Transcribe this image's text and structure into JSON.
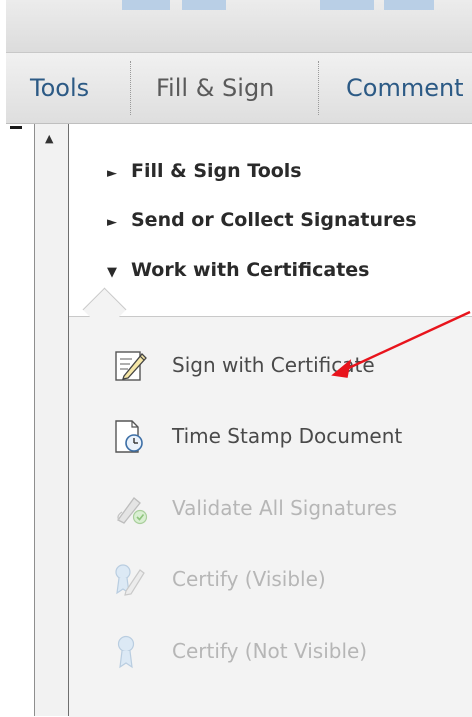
{
  "tabs": [
    {
      "label": "Tools"
    },
    {
      "label": "Fill & Sign"
    },
    {
      "label": "Comment"
    }
  ],
  "sections": [
    {
      "label": "Fill & Sign Tools",
      "expanded": false,
      "marker": "►"
    },
    {
      "label": "Send or Collect Signatures",
      "expanded": false,
      "marker": "►"
    },
    {
      "label": "Work with Certificates",
      "expanded": true,
      "marker": "▼"
    }
  ],
  "certificate_tools": [
    {
      "label": "Sign with Certificate",
      "icon": "sign-pen-icon",
      "enabled": true
    },
    {
      "label": "Time Stamp Document",
      "icon": "clock-document-icon",
      "enabled": true
    },
    {
      "label": "Validate All Signatures",
      "icon": "validate-signature-icon",
      "enabled": false
    },
    {
      "label": "Certify (Visible)",
      "icon": "certify-visible-icon",
      "enabled": false
    },
    {
      "label": "Certify (Not Visible)",
      "icon": "certify-ribbon-icon",
      "enabled": false
    }
  ],
  "scroll": {
    "up_glyph": "▲"
  },
  "colors": {
    "tab_text": "#2c5a85",
    "annotation_arrow": "#e8141c",
    "disabled_text": "#b6b6b6"
  }
}
